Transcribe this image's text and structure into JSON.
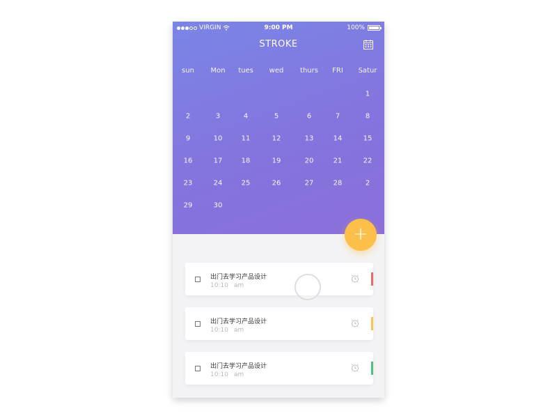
{
  "status_bar": {
    "carrier": "VIRGIN",
    "time": "9:00 PM",
    "battery": "100%"
  },
  "header": {
    "title": "STROKE"
  },
  "weekdays": [
    "sun",
    "Mon",
    "tues",
    "wed",
    "thurs",
    "FRI",
    "Satur"
  ],
  "calendar_days": [
    [
      "",
      "",
      "",
      "",
      "",
      "",
      "1"
    ],
    [
      "2",
      "3",
      "4",
      "5",
      "6",
      "7",
      "8"
    ],
    [
      "9",
      "10",
      "11",
      "12",
      "13",
      "14",
      "15"
    ],
    [
      "16",
      "17",
      "18",
      "19",
      "20",
      "21",
      "22"
    ],
    [
      "23",
      "24",
      "25",
      "26",
      "27",
      "28",
      "2"
    ],
    [
      "29",
      "30",
      "",
      "",
      "",
      "",
      ""
    ]
  ],
  "fab": {
    "label": "+"
  },
  "tasks": [
    {
      "title": "出门去学习产品设计",
      "time": "10:10",
      "ampm": "am",
      "color": "#e96a5f"
    },
    {
      "title": "出门去学习产品设计",
      "time": "10:10",
      "ampm": "am",
      "color": "#f7c54b"
    },
    {
      "title": "出门去学习产品设计",
      "time": "10:10",
      "ampm": "am",
      "color": "#4cc07d"
    }
  ],
  "colors": {
    "header_start": "#7a85e6",
    "header_end": "#8b6fd9",
    "fab": "#fcc04a"
  }
}
